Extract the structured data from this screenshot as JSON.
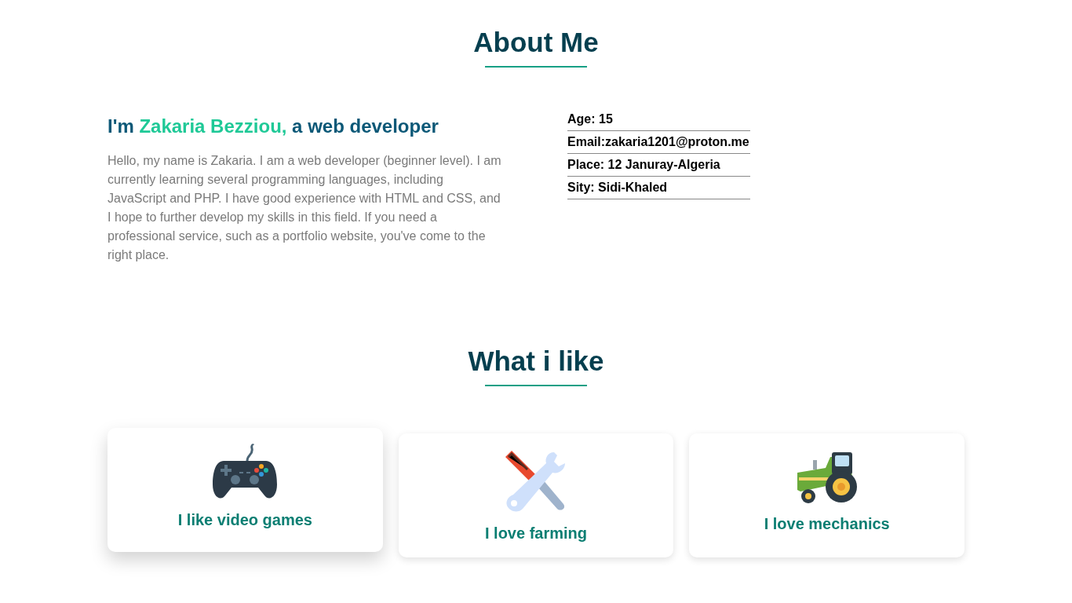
{
  "about": {
    "title": "About Me",
    "intro": {
      "prefix": "I'm ",
      "name": "Zakaria Bezziou,",
      "suffix": " a web developer"
    },
    "bio": "Hello, my name is Zakaria. I am a web developer (beginner level). I am currently learning several programming languages, including JavaScript and PHP. I have good experience with HTML and CSS, and I hope to further develop my skills in this field. If you need a professional service, such as a portfolio website, you've come to the right place.",
    "facts": [
      "Age: 15",
      "Email:zakaria1201@proton.me",
      "Place: 12 Januray-Algeria",
      "Sity: Sidi-Khaled"
    ]
  },
  "likes": {
    "title": "What i like",
    "cards": [
      {
        "kind": "gamepad",
        "label": "I like video games",
        "hovered": true
      },
      {
        "kind": "tools",
        "label": "I love farming",
        "hovered": false
      },
      {
        "kind": "tractor",
        "label": "I love mechanics",
        "hovered": false
      }
    ]
  }
}
